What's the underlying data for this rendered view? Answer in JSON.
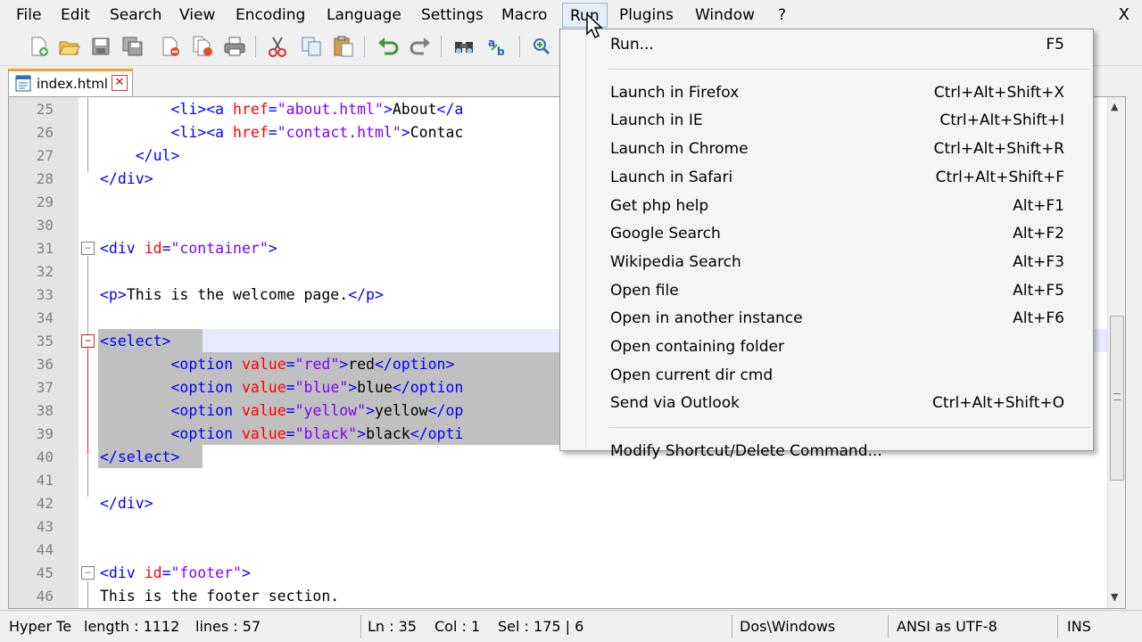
{
  "menubar": {
    "items": [
      "File",
      "Edit",
      "Search",
      "View",
      "Encoding",
      "Language",
      "Settings",
      "Macro",
      "Run",
      "Plugins",
      "Window",
      "?"
    ],
    "close": "X"
  },
  "toolbar": {
    "icons": [
      "new-file-icon",
      "open-file-icon",
      "save-icon",
      "save-all-icon",
      "close-icon",
      "close-all-icon",
      "print-icon",
      "cut-icon",
      "copy-icon",
      "paste-icon",
      "undo-icon",
      "redo-icon",
      "find-icon",
      "replace-icon",
      "zoom-in-icon"
    ]
  },
  "tab": {
    "label": "index.html",
    "close": "✕"
  },
  "editor": {
    "lines": [
      {
        "n": "25",
        "html": "        <span class='t'>&lt;li&gt;&lt;a</span> <span class='a'>href</span><span class='t'>=</span><span class='s'>\"about.html\"</span><span class='t'>&gt;</span>About<span class='t'>&lt;/a</span>"
      },
      {
        "n": "26",
        "html": "        <span class='t'>&lt;li&gt;&lt;a</span> <span class='a'>href</span><span class='t'>=</span><span class='s'>\"contact.html\"</span><span class='t'>&gt;</span>Contac"
      },
      {
        "n": "27",
        "html": "    <span class='t'>&lt;/ul&gt;</span>"
      },
      {
        "n": "28",
        "html": "<span class='t'>&lt;/div&gt;</span>"
      },
      {
        "n": "29",
        "html": ""
      },
      {
        "n": "30",
        "html": ""
      },
      {
        "n": "31",
        "html": "<span class='t'>&lt;div</span> <span class='a'>id</span><span class='t'>=</span><span class='s'>\"container\"</span><span class='t'>&gt;</span>"
      },
      {
        "n": "32",
        "html": ""
      },
      {
        "n": "33",
        "html": "<span class='t'>&lt;p&gt;</span>This is the welcome page.<span class='t'>&lt;/p&gt;</span>"
      },
      {
        "n": "34",
        "html": ""
      },
      {
        "n": "35",
        "html": "<span class='t'>&lt;select&gt;</span>"
      },
      {
        "n": "36",
        "html": "        <span class='t'>&lt;option</span> <span class='a'>value</span><span class='t'>=</span><span class='s'>\"red\"</span><span class='t'>&gt;</span>red<span class='t'>&lt;/option&gt;</span>"
      },
      {
        "n": "37",
        "html": "        <span class='t'>&lt;option</span> <span class='a'>value</span><span class='t'>=</span><span class='s'>\"blue\"</span><span class='t'>&gt;</span>blue<span class='t'>&lt;/option</span>"
      },
      {
        "n": "38",
        "html": "        <span class='t'>&lt;option</span> <span class='a'>value</span><span class='t'>=</span><span class='s'>\"yellow\"</span><span class='t'>&gt;</span>yellow<span class='t'>&lt;/op</span>"
      },
      {
        "n": "39",
        "html": "        <span class='t'>&lt;option</span> <span class='a'>value</span><span class='t'>=</span><span class='s'>\"black\"</span><span class='t'>&gt;</span>black<span class='t'>&lt;/opti</span>"
      },
      {
        "n": "40",
        "html": "<span class='t'>&lt;/select&gt;</span>"
      },
      {
        "n": "41",
        "html": ""
      },
      {
        "n": "42",
        "html": "<span class='t'>&lt;/div&gt;</span>"
      },
      {
        "n": "43",
        "html": ""
      },
      {
        "n": "44",
        "html": ""
      },
      {
        "n": "45",
        "html": "<span class='t'>&lt;div</span> <span class='a'>id</span><span class='t'>=</span><span class='s'>\"footer\"</span><span class='t'>&gt;</span>"
      },
      {
        "n": "46",
        "html": "This is the footer section."
      }
    ]
  },
  "statusbar": {
    "filetype": "Hyper Te",
    "length": "length : 1112",
    "lines": "lines : 57",
    "ln": "Ln : 35",
    "col": "Col : 1",
    "sel": "Sel : 175 | 6",
    "eol": "Dos\\Windows",
    "encoding": "ANSI as UTF-8",
    "mode": "INS"
  },
  "run_menu": {
    "items": [
      {
        "label": "Run...",
        "shortcut": "F5"
      },
      {
        "separator": true
      },
      {
        "label": "Launch in Firefox",
        "shortcut": "Ctrl+Alt+Shift+X"
      },
      {
        "label": "Launch in IE",
        "shortcut": "Ctrl+Alt+Shift+I"
      },
      {
        "label": "Launch in Chrome",
        "shortcut": "Ctrl+Alt+Shift+R"
      },
      {
        "label": "Launch in Safari",
        "shortcut": "Ctrl+Alt+Shift+F"
      },
      {
        "label": "Get php help",
        "shortcut": "Alt+F1"
      },
      {
        "label": "Google Search",
        "shortcut": "Alt+F2"
      },
      {
        "label": "Wikipedia Search",
        "shortcut": "Alt+F3"
      },
      {
        "label": "Open file",
        "shortcut": "Alt+F5"
      },
      {
        "label": "Open in another instance",
        "shortcut": "Alt+F6"
      },
      {
        "label": "Open containing folder",
        "shortcut": ""
      },
      {
        "label": "Open current dir cmd",
        "shortcut": ""
      },
      {
        "label": "Send via Outlook",
        "shortcut": "Ctrl+Alt+Shift+O"
      },
      {
        "separator": true
      },
      {
        "label": "Modify Shortcut/Delete Command...",
        "shortcut": ""
      }
    ]
  }
}
